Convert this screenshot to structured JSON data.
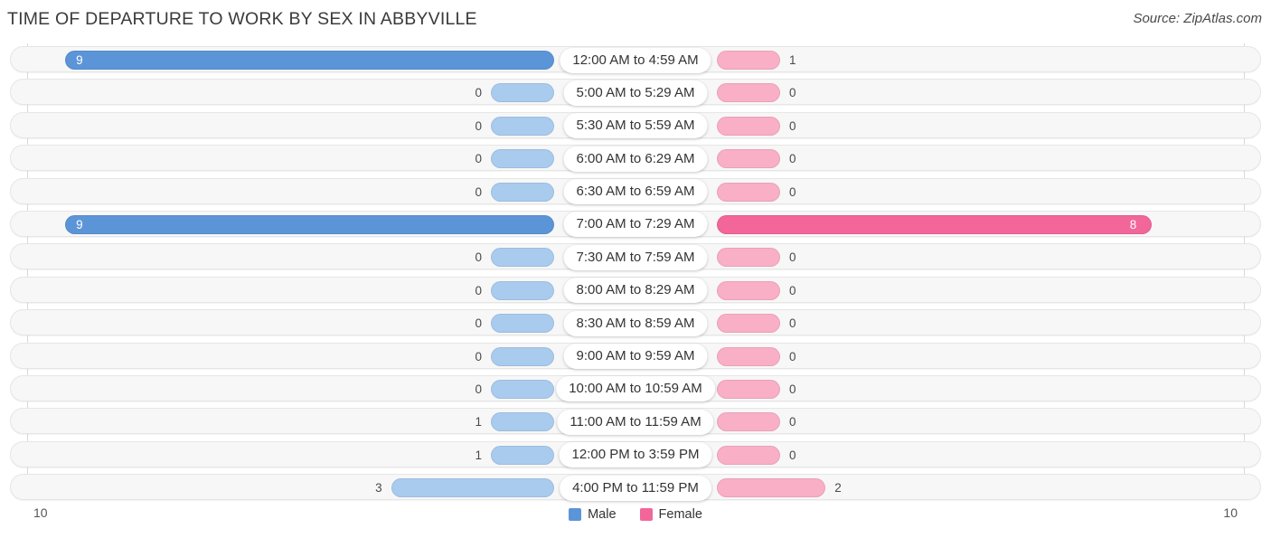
{
  "header": {
    "title": "TIME OF DEPARTURE TO WORK BY SEX IN ABBYVILLE",
    "source": "Source: ZipAtlas.com"
  },
  "legend": {
    "male_label": "Male",
    "female_label": "Female",
    "male_color": "#5b95d8",
    "female_color": "#f2669a"
  },
  "axis": {
    "left_tick": "10",
    "right_tick": "10",
    "max": 10
  },
  "colors": {
    "male_strong": "#5b95d8",
    "male_light": "#a9cbee",
    "female_strong": "#f2669a",
    "female_light": "#f9afc5",
    "track_bg": "#f7f7f7",
    "track_border": "#e6e6e6",
    "axis_line": "#d9d9d9",
    "title_text": "#3b3b3b",
    "value_text": "#4a4a4a"
  },
  "chart_data": {
    "type": "bar",
    "orientation": "horizontal-diverging",
    "title": "TIME OF DEPARTURE TO WORK BY SEX IN ABBYVILLE",
    "xlabel": "",
    "ylabel": "",
    "xlim": [
      10,
      10
    ],
    "grid": false,
    "legend_position": "bottom-center",
    "categories": [
      "12:00 AM to 4:59 AM",
      "5:00 AM to 5:29 AM",
      "5:30 AM to 5:59 AM",
      "6:00 AM to 6:29 AM",
      "6:30 AM to 6:59 AM",
      "7:00 AM to 7:29 AM",
      "7:30 AM to 7:59 AM",
      "8:00 AM to 8:29 AM",
      "8:30 AM to 8:59 AM",
      "9:00 AM to 9:59 AM",
      "10:00 AM to 10:59 AM",
      "11:00 AM to 11:59 AM",
      "12:00 PM to 3:59 PM",
      "4:00 PM to 11:59 PM"
    ],
    "series": [
      {
        "name": "Male",
        "values": [
          9,
          0,
          0,
          0,
          0,
          9,
          0,
          0,
          0,
          0,
          0,
          1,
          1,
          3
        ],
        "labels": [
          "9",
          "0",
          "0",
          "0",
          "0",
          "9",
          "0",
          "0",
          "0",
          "0",
          "0",
          "1",
          "1",
          "3"
        ]
      },
      {
        "name": "Female",
        "values": [
          1,
          0,
          0,
          0,
          0,
          8,
          0,
          0,
          0,
          0,
          0,
          0,
          0,
          2
        ],
        "labels": [
          "1",
          "0",
          "0",
          "0",
          "0",
          "8",
          "0",
          "0",
          "0",
          "0",
          "0",
          "0",
          "0",
          "2"
        ]
      }
    ]
  }
}
